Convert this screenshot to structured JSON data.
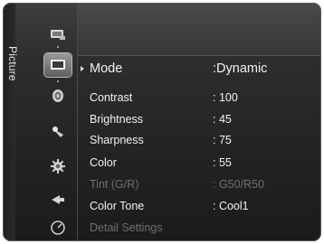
{
  "side_tab": {
    "label": "Picture"
  },
  "icons": [
    {
      "name": "input-list-icon"
    },
    {
      "name": "picture-icon",
      "selected": true
    },
    {
      "name": "sound-icon"
    },
    {
      "name": "channel-icon"
    },
    {
      "name": "setup-icon"
    },
    {
      "name": "input-icon"
    },
    {
      "name": "application-icon"
    }
  ],
  "menu": {
    "mode": {
      "label": "Mode",
      "value": ":Dynamic"
    },
    "items": [
      {
        "label": "Contrast",
        "value": ": 100"
      },
      {
        "label": "Brightness",
        "value": ": 45"
      },
      {
        "label": "Sharpness",
        "value": ": 75"
      },
      {
        "label": "Color",
        "value": ": 55"
      },
      {
        "label": "Tint (G/R)",
        "value": ": G50/R50",
        "disabled": true
      },
      {
        "label": "Color Tone",
        "value": ": Cool1"
      },
      {
        "label": "Detail Settings",
        "value": "",
        "disabled": true
      }
    ]
  }
}
